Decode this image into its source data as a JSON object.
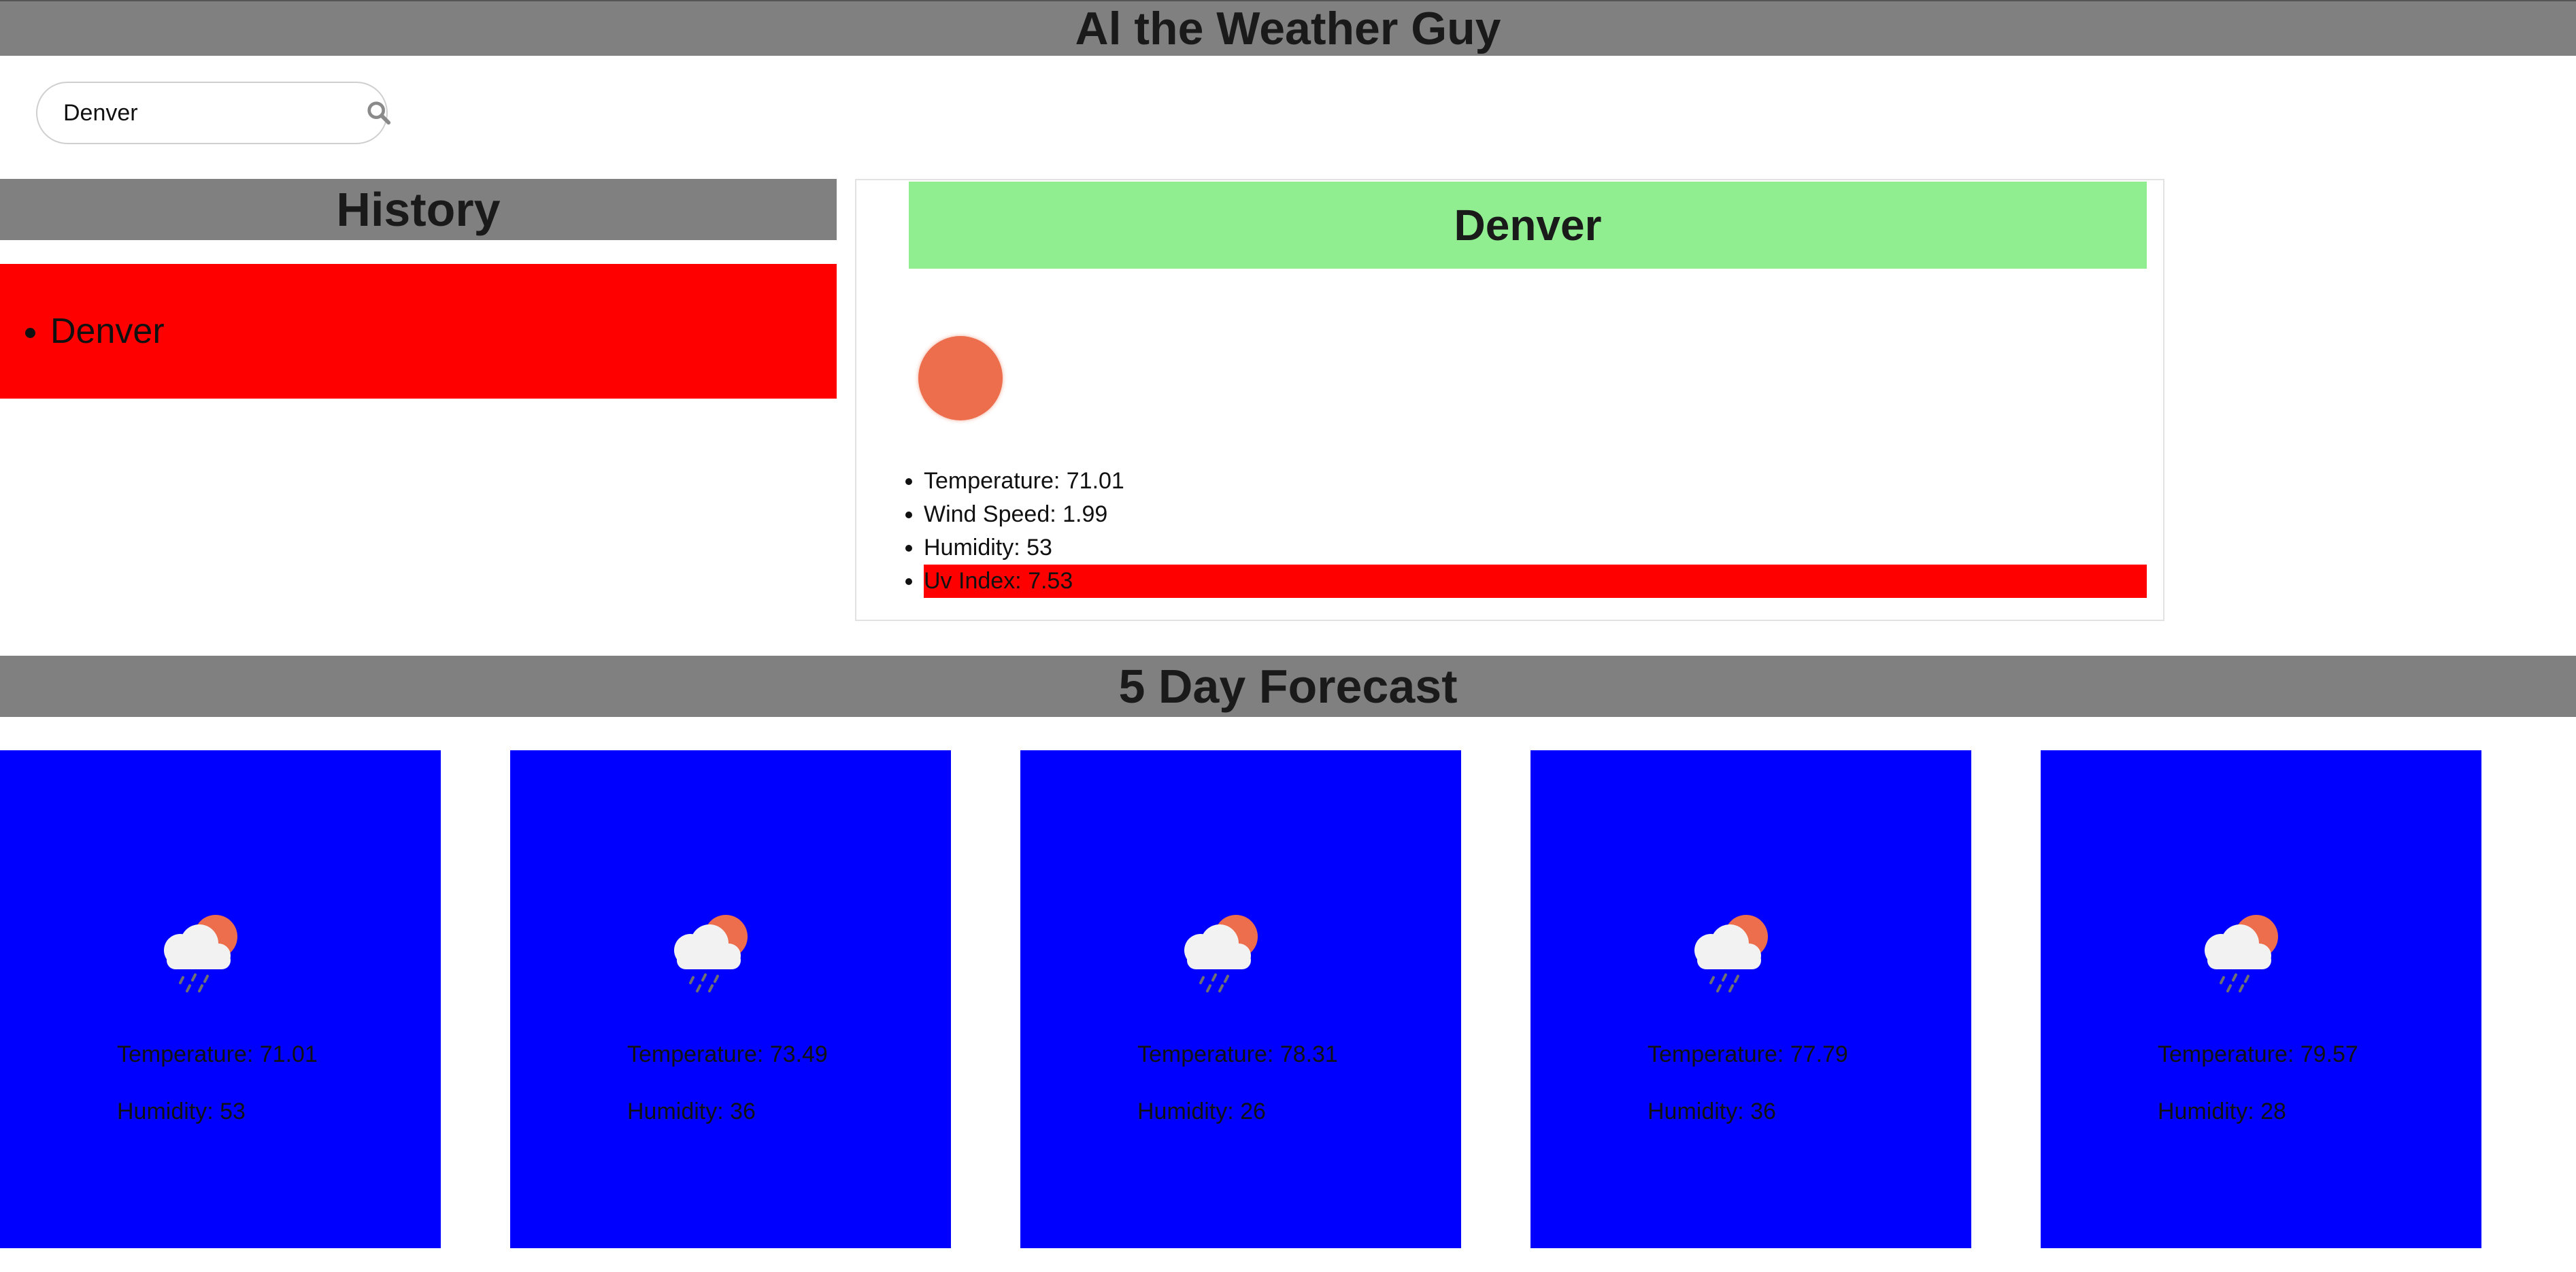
{
  "app": {
    "title": "Al the Weather Guy"
  },
  "search": {
    "value": "Denver"
  },
  "history": {
    "title": "History",
    "items": [
      "Denver"
    ]
  },
  "current": {
    "city": "Denver",
    "icon": "sun-icon",
    "details": [
      "Temperature: 71.01",
      "Wind Speed: 1.99",
      "Humidity: 53",
      "Uv Index: 7.53"
    ]
  },
  "forecast": {
    "title": "5 Day Forecast",
    "icon": "cloud-sun-rain-icon",
    "days": [
      {
        "temperature": "Temperature: 71.01",
        "humidity": "Humidity: 53"
      },
      {
        "temperature": "Temperature: 73.49",
        "humidity": "Humidity: 36"
      },
      {
        "temperature": "Temperature: 78.31",
        "humidity": "Humidity: 26"
      },
      {
        "temperature": "Temperature: 77.79",
        "humidity": "Humidity: 36"
      },
      {
        "temperature": "Temperature: 79.57",
        "humidity": "Humidity: 28"
      }
    ]
  },
  "colors": {
    "header_bg": "#808080",
    "history_bg": "#ff0000",
    "city_banner_bg": "#90ee90",
    "uv_highlight": "#ff0000",
    "forecast_card_bg": "#0000ff"
  }
}
